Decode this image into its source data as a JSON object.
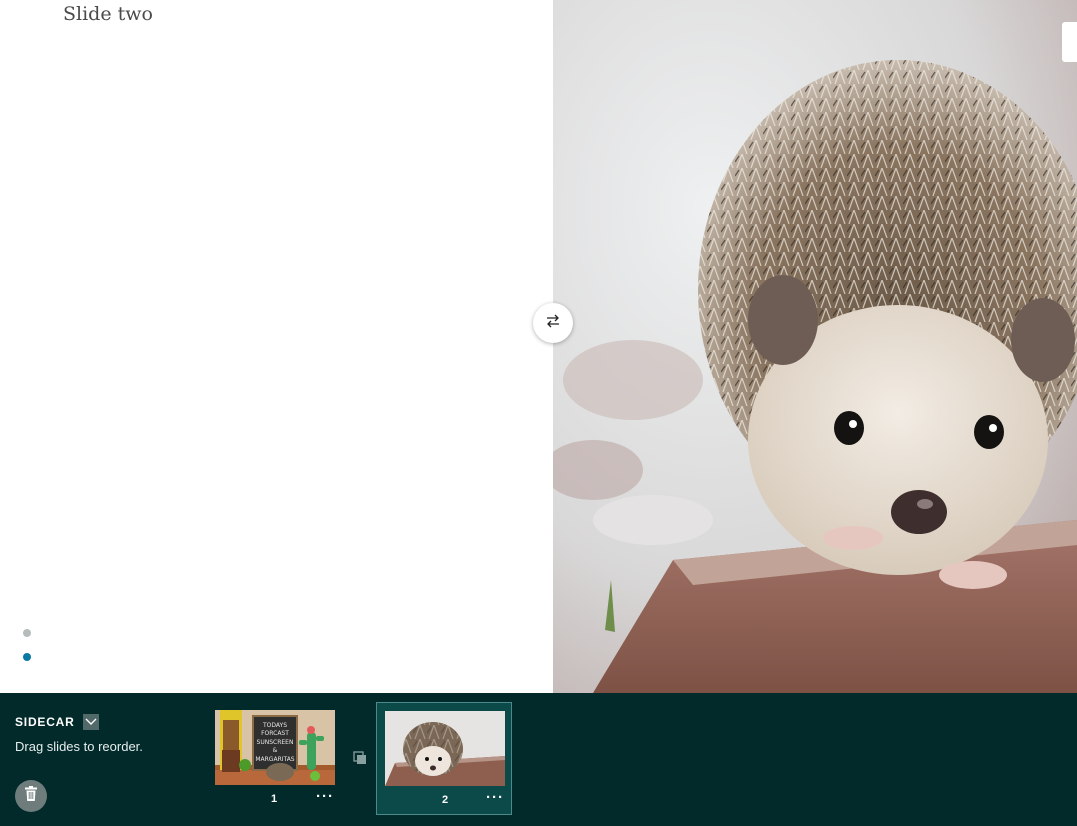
{
  "slide": {
    "heading": "Slide two"
  },
  "pagination": {
    "dots": [
      {
        "color": "#b5bcbc",
        "active": false
      },
      {
        "color": "#0a7aa3",
        "active": true
      }
    ]
  },
  "media": {
    "description_icon": "hedgehog-photo"
  },
  "swap_button": {
    "icon": "swap-arrows-icon"
  },
  "builder": {
    "title": "SIDECAR",
    "hint": "Drag slides to reorder.",
    "thumbnails": [
      {
        "number": "1",
        "more": "···",
        "sign_lines": [
          "TODAYS",
          "FORCAST",
          "SUNSCREEN",
          "&",
          "MARGARITAS"
        ]
      },
      {
        "number": "2",
        "more": "···"
      }
    ]
  },
  "colors": {
    "builder_bg": "#022a2a",
    "selected_thumb": "#0c4949",
    "active_dot": "#0a7aa3"
  }
}
